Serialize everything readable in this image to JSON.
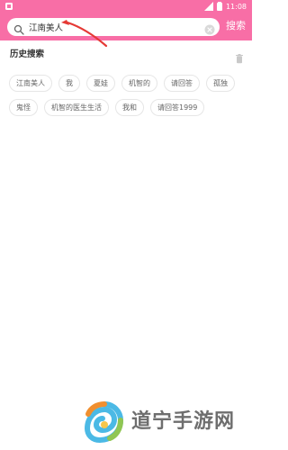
{
  "status_bar": {
    "time": "11:08",
    "bar_color": "#f86ea6"
  },
  "search": {
    "value": "江南美人",
    "button_label": "搜索"
  },
  "history": {
    "title": "历史搜索",
    "tags": [
      {
        "label": "江南美人"
      },
      {
        "label": "我"
      },
      {
        "label": "夏娃"
      },
      {
        "label": "机智的"
      },
      {
        "label": "请回答"
      },
      {
        "label": "孤独"
      },
      {
        "label": "鬼怪"
      },
      {
        "label": "机智的医生生活"
      },
      {
        "label": "我和"
      },
      {
        "label": "请回答1999"
      }
    ]
  },
  "watermark": {
    "text": "道宁手游网"
  },
  "icons": {
    "status_left": "notification-icon",
    "signal": "signal-icon",
    "battery": "battery-icon",
    "search": "search-icon",
    "clear": "clear-icon",
    "trash": "trash-icon"
  },
  "colors": {
    "accent": "#f86ea6",
    "tag_border": "#e6e6e6",
    "annotation": "#e53935"
  }
}
